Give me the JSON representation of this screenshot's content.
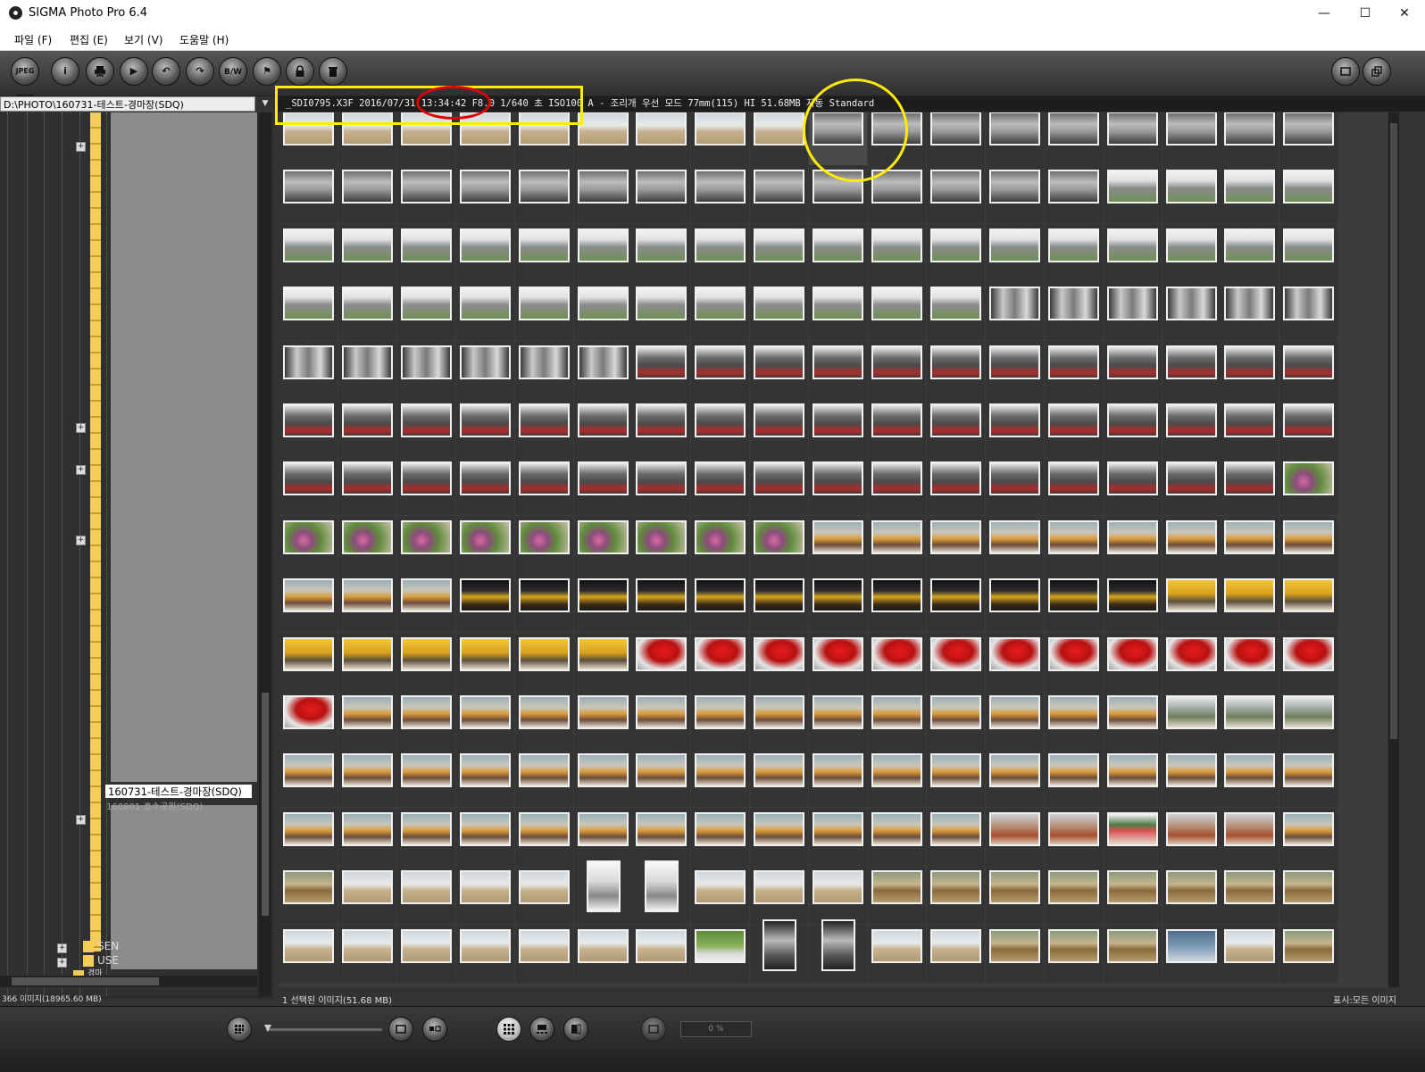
{
  "window": {
    "title": "SIGMA Photo Pro 6.4",
    "minimize_icon": "minimize-icon",
    "maximize_icon": "maximize-icon",
    "close_icon": "close-icon"
  },
  "menu": {
    "items": [
      "파일 (F)",
      "편집 (E)",
      "보기 (V)",
      "도움말 (H)"
    ]
  },
  "toolbar": {
    "buttons": [
      {
        "name": "convert-jpeg-tiff-button",
        "label": "JPEG TIFF",
        "icon": "jpeg-tiff-icon"
      },
      {
        "name": "info-button",
        "label": "i",
        "icon": "info-icon"
      },
      {
        "name": "print-button",
        "label": "",
        "icon": "print-icon"
      },
      {
        "name": "slideshow-button",
        "label": "▶",
        "icon": "play-icon"
      },
      {
        "name": "rotate-left-button",
        "label": "↶",
        "icon": "rotate-left-icon"
      },
      {
        "name": "rotate-right-button",
        "label": "↷",
        "icon": "rotate-right-icon"
      },
      {
        "name": "bw-button",
        "label": "B/W",
        "icon": "bw-icon"
      },
      {
        "name": "flag-button",
        "label": "⚑",
        "icon": "flag-icon"
      },
      {
        "name": "lock-button",
        "label": "",
        "icon": "lock-icon"
      },
      {
        "name": "delete-button",
        "label": "",
        "icon": "trash-icon"
      }
    ],
    "right_buttons": [
      {
        "name": "window-mode-button",
        "icon": "window-icon"
      },
      {
        "name": "restore-view-button",
        "icon": "restore-icon"
      }
    ]
  },
  "browser": {
    "path": "D:\\PHOTO\\160731-테스트-경마장(SDQ)",
    "info": "_SDI0795.X3F 2016/07/31 13:34:42 F8.0 1/640 초 ISO100 A - 조리개 우선 모드 77mm(115) HI 51.68MB 자동 Standard",
    "selected_folder": "160731-테스트-경마장(SDQ)",
    "below_folder": "160801-호수공원(SDQ)",
    "bottom_folders": [
      "SEN",
      "USE",
      "경마"
    ]
  },
  "status": {
    "left": "366 이미지(18965.60 MB)",
    "middle": "1 선택된 이미지(51.68 MB)",
    "right": "표시:모든 이미지"
  },
  "bottom": {
    "zoom": "0 %"
  },
  "colors": {
    "highlight_yellow": "#ffec00",
    "highlight_red": "#e00000",
    "folder_yellow": "#f4cc58"
  },
  "thumbnails": {
    "rows": [
      "t,t,t,t,t,t,t,t,t,f,f,f,f,f,f,f,f,f",
      "f,f,f,f,f,f,f,f,f,f,f,f,f,f,s,s,s,s",
      "s,s,s,s,s,s,s,s,s,s,s,s,s,s,s,s,s,s",
      "s,s,s,s,s,s,s,s,s,s,s,s,a,a,a,a,a,a",
      "a,a,a,a,a,a,g,g,g,g,g,g,g,g,g,g,g,g",
      "g,g,g,g,g,g,g,g,g,g,g,g,g,g,g,g,g,g",
      "g,g,g,g,g,g,g,g,g,g,g,g,g,g,g,g,g,p",
      "p,p,p,p,p,p,p,p,p,c,c,c,c,c,c,c,c,c",
      "c,c,c,d,d,d,d,d,d,d,d,d,d,d,d,u,u,u",
      "u,u,u,u,u,u,r,r,r,r,r,r,r,r,r,r,r,r",
      "r,c,c,c,c,c,c,c,c,c,c,c,c,c,c,k,k,k",
      "c,c,c,c,c,c,c,c,c,c,c,c,c,c,c,c,c,c",
      "c,c,c,c,c,c,c,c,c,c,c,c,w,w,b,w,w,c",
      "h,t,t,t,t,n,n,t,t,t,h,h,h,h,h,h,h,h",
      "t,t,t,t,t,t,t,o,v,v,t,t,h,h,h,y,t,h"
    ]
  }
}
